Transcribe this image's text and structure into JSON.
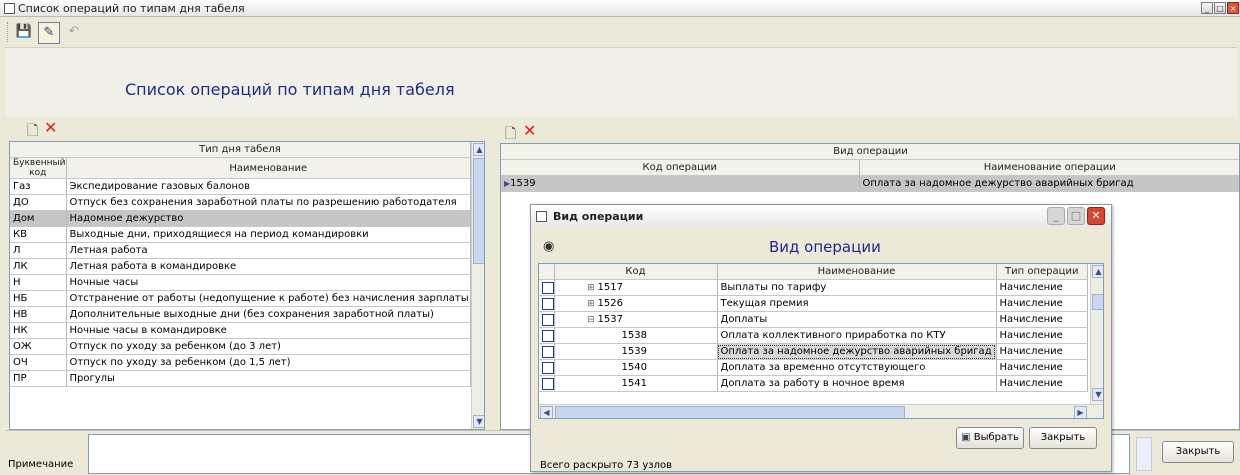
{
  "window": {
    "title": "Список операций по типам дня табеля"
  },
  "header": {
    "title": "Список операций по типам дня табеля"
  },
  "left_grid": {
    "group_header": "Тип дня табеля",
    "col_code": "Буквенный код",
    "col_name": "Наименование",
    "rows": [
      {
        "code": "Газ",
        "name": "Экспедирование газовых балонов"
      },
      {
        "code": "ДО",
        "name": "Отпуск без сохранения заработной платы по разрешению работодателя"
      },
      {
        "code": "Дом",
        "name": "Надомное дежурство"
      },
      {
        "code": "КВ",
        "name": "Выходные дни, приходящиеся на период командировки"
      },
      {
        "code": "Л",
        "name": "Летная работа"
      },
      {
        "code": "ЛК",
        "name": "Летная работа в командировке"
      },
      {
        "code": "Н",
        "name": "Ночные часы"
      },
      {
        "code": "НБ",
        "name": "Отстранение от работы (недопущение к работе) без начисления зарплаты"
      },
      {
        "code": "НВ",
        "name": "Дополнительные выходные дни (без сохранения заработной платы)"
      },
      {
        "code": "НК",
        "name": "Ночные часы в командировке"
      },
      {
        "code": "ОЖ",
        "name": "Отпуск по уходу за ребенком (до 3 лет)"
      },
      {
        "code": "ОЧ",
        "name": "Отпуск по уходу за ребенком (до 1,5 лет)"
      },
      {
        "code": "ПР",
        "name": "Прогулы"
      }
    ]
  },
  "right_grid": {
    "group_header": "Вид операции",
    "col_code": "Код операции",
    "col_name": "Наименование операции",
    "rows": [
      {
        "code": "1539",
        "name": "Оплата за надомное дежурство аварийных бригад"
      }
    ]
  },
  "footer": {
    "note_label": "Примечание",
    "close_label": "Закрыть"
  },
  "dialog": {
    "title": "Вид операции",
    "heading": "Вид операции",
    "col_code": "Код",
    "col_name": "Наименование",
    "col_type": "Тип операции",
    "rows": [
      {
        "code": "1517",
        "name": "Выплаты по тарифу",
        "type": "Начисление"
      },
      {
        "code": "1526",
        "name": "Текущая премия",
        "type": "Начисление"
      },
      {
        "code": "1537",
        "name": "Доплаты",
        "type": "Начисление"
      },
      {
        "code": "1538",
        "name": "Оплата коллективного приработка по КТУ",
        "type": "Начисление"
      },
      {
        "code": "1539",
        "name": "Оплата за надомное дежурство аварийных бригад",
        "type": "Начисление"
      },
      {
        "code": "1540",
        "name": "Доплата за временно отсутствующего",
        "type": "Начисление"
      },
      {
        "code": "1541",
        "name": "Доплата за работу в ночное время",
        "type": "Начисление"
      }
    ],
    "select_label": "Выбрать",
    "close_label": "Закрыть",
    "status": "Всего раскрыто 73 узлов"
  }
}
